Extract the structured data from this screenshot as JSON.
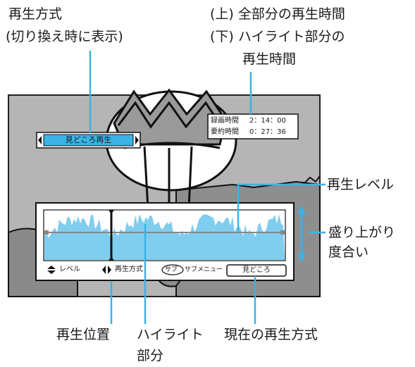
{
  "callouts": {
    "mode_title": "再生方式",
    "mode_sub": "(切り換え時に表示)",
    "time_line1": "(上) 全部分の再生時間",
    "time_line2": "(下) ハイライト部分の",
    "time_line3": "再生時間",
    "level_label": "再生レベル",
    "excite_line1": "盛り上がり",
    "excite_line2": "度合い",
    "position_label": "再生位置",
    "highlight_line1": "ハイライト",
    "highlight_line2": "部分",
    "current_mode_label": "現在の再生方式"
  },
  "osd": {
    "mode_selector": "見どころ再生",
    "rec_time_label": "録画時間",
    "rec_time_value": "2：14：00",
    "sum_time_label": "要約時間",
    "sum_time_value": "0：27：36",
    "footer_level": "レベル",
    "footer_mode": "再生方式",
    "footer_sub_icon": "サブ",
    "footer_sub_menu": "サブメニュー",
    "current_mode": "見どころ"
  },
  "colors": {
    "accent_cyan": "#3bb3e6",
    "graph_fill": "#7fcdef",
    "osd_bg": "#ffffff",
    "tv_bg": "#b5b5b5"
  }
}
